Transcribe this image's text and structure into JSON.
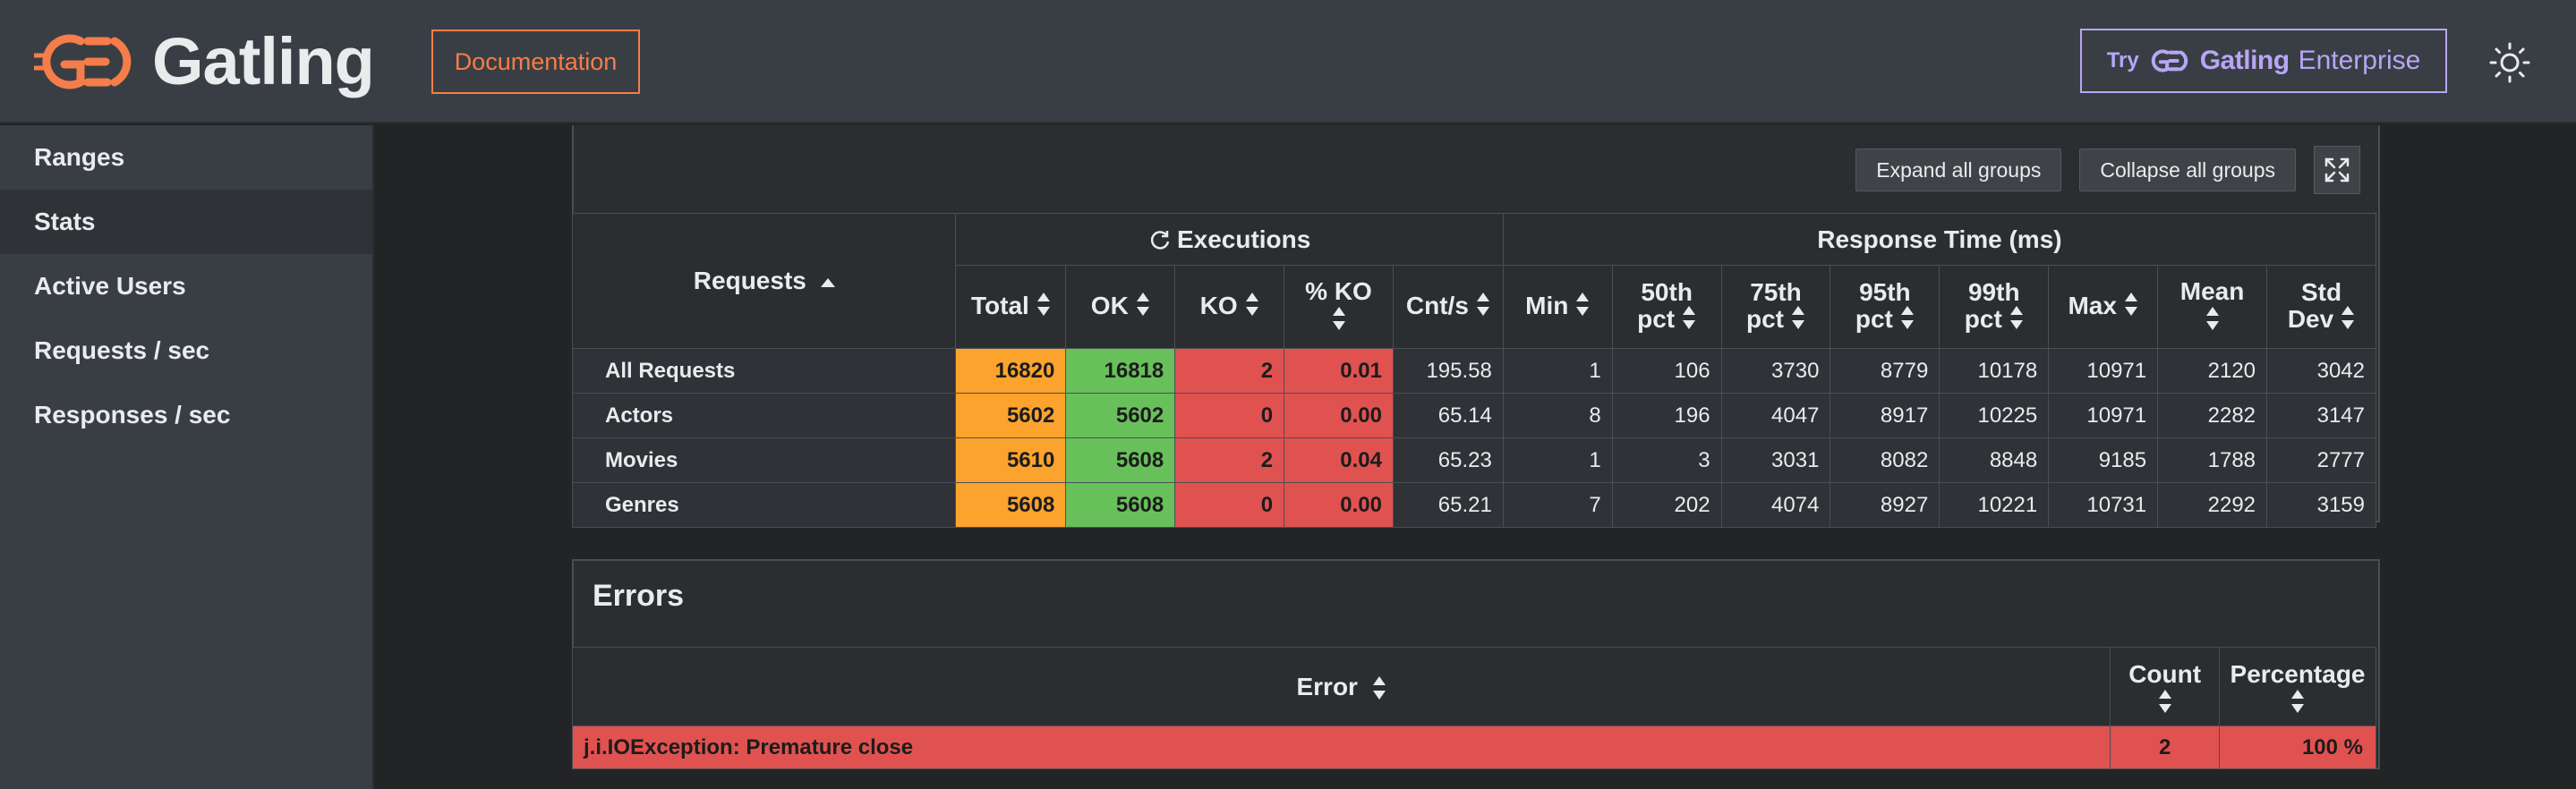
{
  "header": {
    "brand": "Gatling",
    "documentation_label": "Documentation",
    "enterprise": {
      "try": "Try",
      "brand": "Gatling",
      "suffix": "Enterprise"
    },
    "theme_icon": "sun-icon"
  },
  "colors": {
    "header_bg": "#393e44",
    "accent_orange": "#f57d4a",
    "enterprise_purple": "#b7a6f5",
    "total_cell": "#fca32d",
    "ok_cell": "#68c05b",
    "ko_cell": "#e05250"
  },
  "sidebar": {
    "items": [
      {
        "label": "Ranges"
      },
      {
        "label": "Stats",
        "active": true
      },
      {
        "label": "Active Users"
      },
      {
        "label": "Requests / sec"
      },
      {
        "label": "Responses / sec"
      }
    ]
  },
  "stats": {
    "buttons": {
      "expand": "Expand all groups",
      "collapse": "Collapse all groups"
    },
    "groups": {
      "executions": "Executions",
      "response_time": "Response Time (ms)"
    },
    "requests_header": "Requests",
    "columns": [
      {
        "line1": "Total"
      },
      {
        "line1": "OK"
      },
      {
        "line1": "KO"
      },
      {
        "line1": "% KO"
      },
      {
        "line1": "Cnt/s"
      },
      {
        "line1": "Min"
      },
      {
        "line1": "50th",
        "line2": "pct"
      },
      {
        "line1": "75th",
        "line2": "pct"
      },
      {
        "line1": "95th",
        "line2": "pct"
      },
      {
        "line1": "99th",
        "line2": "pct"
      },
      {
        "line1": "Max"
      },
      {
        "line1": "Mean"
      },
      {
        "line1": "Std",
        "line2": "Dev"
      }
    ],
    "rows": [
      {
        "name": "All Requests",
        "values": [
          "16820",
          "16818",
          "2",
          "0.01",
          "195.58",
          "1",
          "106",
          "3730",
          "8779",
          "10178",
          "10971",
          "2120",
          "3042"
        ]
      },
      {
        "name": "Actors",
        "values": [
          "5602",
          "5602",
          "0",
          "0.00",
          "65.14",
          "8",
          "196",
          "4047",
          "8917",
          "10225",
          "10971",
          "2282",
          "3147"
        ]
      },
      {
        "name": "Movies",
        "values": [
          "5610",
          "5608",
          "2",
          "0.04",
          "65.23",
          "1",
          "3",
          "3031",
          "8082",
          "8848",
          "9185",
          "1788",
          "2777"
        ]
      },
      {
        "name": "Genres",
        "values": [
          "5608",
          "5608",
          "0",
          "0.00",
          "65.21",
          "7",
          "202",
          "4074",
          "8927",
          "10221",
          "10731",
          "2292",
          "3159"
        ]
      }
    ]
  },
  "errors": {
    "title": "Errors",
    "headers": {
      "error": "Error",
      "count": "Count",
      "percentage": "Percentage"
    },
    "rows": [
      {
        "error": "j.i.IOException: Premature close",
        "count": "2",
        "percentage": "100 %"
      }
    ]
  }
}
